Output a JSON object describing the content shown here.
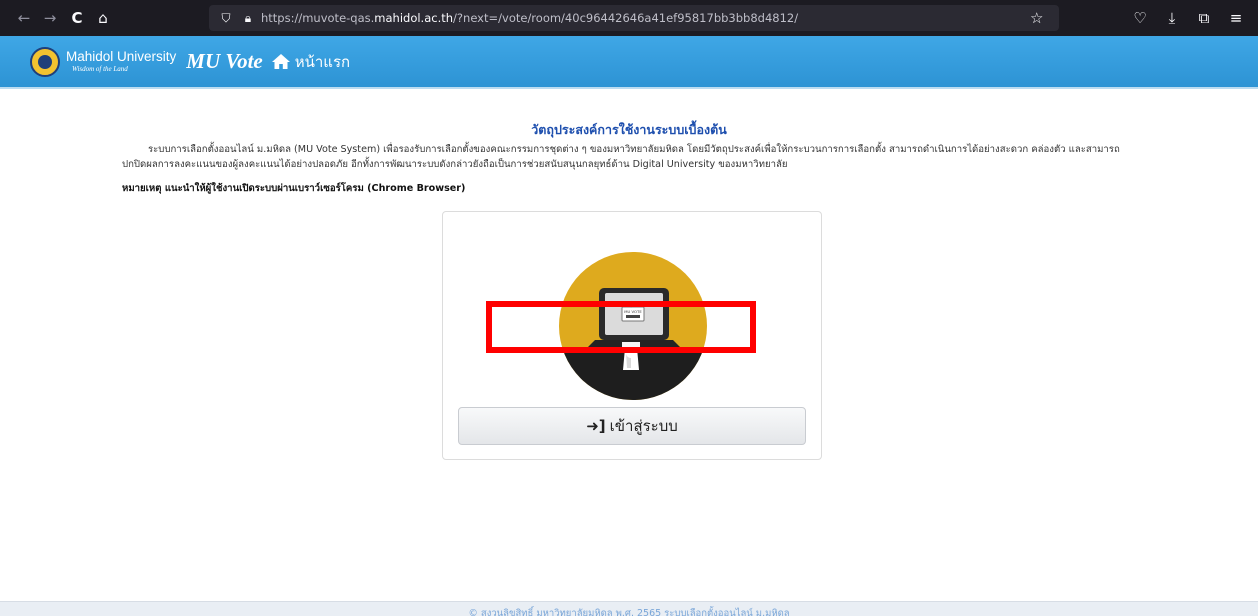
{
  "browser": {
    "url_prefix": "https://muvote-qas.",
    "url_domain": "mahidol.ac.th",
    "url_path": "/?next=/vote/room/40c96442646a41ef95817bb3bb8d4812/",
    "back_icon": "←",
    "forward_icon": "→",
    "reload_icon": "C",
    "home_icon": "⌂",
    "bookmark_icon": "☆",
    "pocket_icon": "♡",
    "download_icon": "⤓",
    "extensions_icon": "⧉",
    "menu_icon": "≡"
  },
  "header": {
    "university_name": "Mahidol University",
    "motto": "Wisdom of the Land",
    "brand": "MU Vote",
    "home_label": "หน้าแรก"
  },
  "main": {
    "purpose_title": "วัตถุประสงค์การใช้งานระบบเบื้องต้น",
    "description": "ระบบการเลือกตั้งออนไลน์ ม.มหิดล (MU Vote System) เพื่อรองรับการเลือกตั้งของคณะกรรมการชุดต่าง ๆ ของมหาวิทยาลัยมหิดล โดยมีวัตถุประสงค์เพื่อให้กระบวนการการเลือกตั้ง สามารถดำเนินการได้อย่างสะดวก คล่องตัว และสามารถปกปิดผลการลงคะแนนของผู้ลงคะแนนได้อย่างปลอดภัย อีกทั้งการพัฒนาระบบดังกล่าวยังถือเป็นการช่วยสนับสนุนกลยุทธ์ด้าน Digital University ของมหาวิทยาลัย",
    "note": "หมายเหตุ แนะนำให้ผู้ใช้งานเปิดระบบผ่านเบราว์เซอร์โครม (Chrome Browser)",
    "illustration_label": "MU VOTE",
    "login_label": "เข้าสู่ระบบ"
  },
  "footer": {
    "text": "© สงวนลิขสิทธิ์ มหาวิทยาลัยมหิดล พ.ศ. 2565 ระบบเลือกตั้งออนไลน์ ม.มหิดล"
  },
  "colors": {
    "header_blue": "#3fa7e6",
    "title_blue": "#1e4fae",
    "illustration_gold": "#deaa1e",
    "highlight_red": "#ff0000"
  }
}
